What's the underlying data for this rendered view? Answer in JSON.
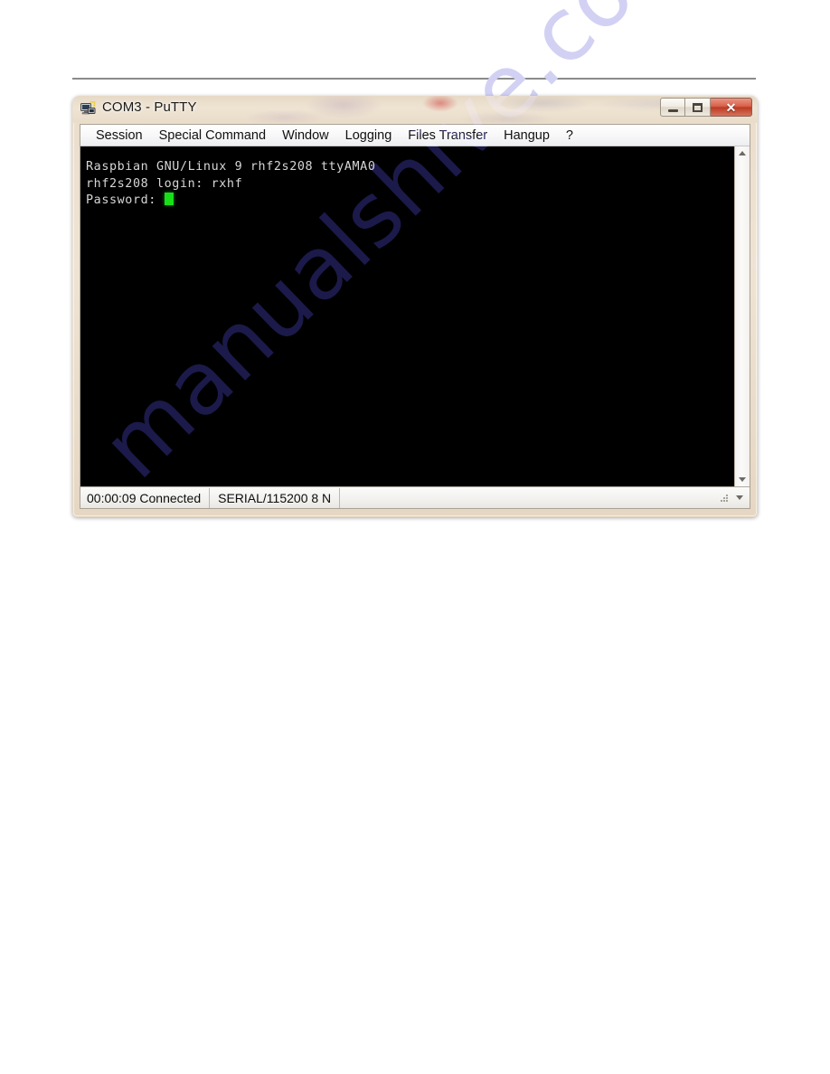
{
  "document": {
    "background_color": "#ffffff",
    "header_rule": true,
    "watermark_text": "manualshive.com",
    "watermark_color_light": "#ccccee",
    "watermark_color_dark": "#1c1a4a"
  },
  "window": {
    "title": "COM3 - PuTTY",
    "title_icon": "putty-terminal-icon",
    "frame_color": "#e9dcc9",
    "controls": {
      "minimize_label": "Minimize",
      "maximize_label": "Maximize",
      "close_label": "Close",
      "close_glyph": "✕",
      "close_color": "#c0392b"
    }
  },
  "menu": {
    "items": [
      {
        "label": "Session"
      },
      {
        "label": "Special Command"
      },
      {
        "label": "Window"
      },
      {
        "label": "Logging"
      },
      {
        "label": "Files Transfer"
      },
      {
        "label": "Hangup"
      },
      {
        "label": "?"
      }
    ]
  },
  "terminal": {
    "background_color": "#000000",
    "text_color": "#d6d6d6",
    "cursor_color": "#18e018",
    "lines": [
      "Raspbian GNU/Linux 9 rhf2s208 ttyAMA0",
      "rhf2s208 login: rxhf",
      "Password: "
    ],
    "cursor_visible": true
  },
  "scrollbar": {
    "up_arrow": "scroll-up-arrow",
    "down_arrow": "scroll-down-arrow",
    "orientation": "vertical"
  },
  "status_bar": {
    "elapsed_time": "00:00:09",
    "connection_state": "Connected",
    "time_and_state": "00:00:09 Connected",
    "port_settings": "SERIAL/115200 8 N",
    "resize_grip": "resize-grip"
  }
}
